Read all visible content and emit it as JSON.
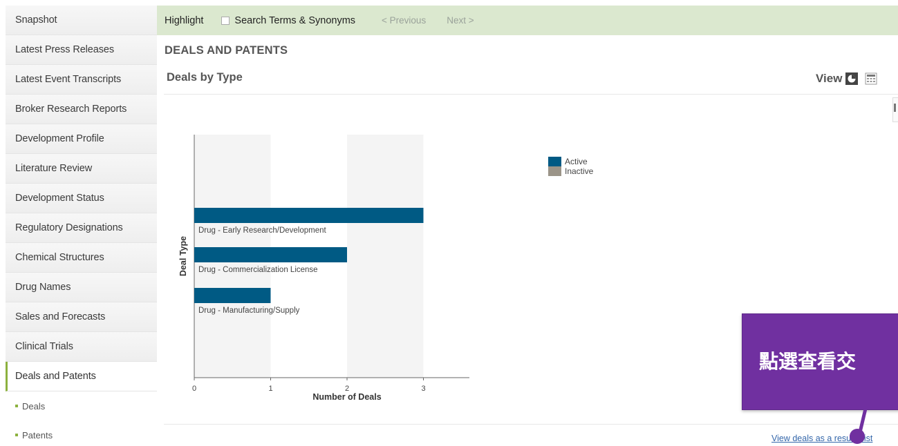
{
  "sidebar": {
    "items": [
      {
        "label": "Snapshot"
      },
      {
        "label": "Latest Press Releases"
      },
      {
        "label": "Latest Event Transcripts"
      },
      {
        "label": "Broker Research Reports"
      },
      {
        "label": "Development Profile"
      },
      {
        "label": "Literature Review"
      },
      {
        "label": "Development Status"
      },
      {
        "label": "Regulatory Designations"
      },
      {
        "label": "Chemical Structures"
      },
      {
        "label": "Drug Names"
      },
      {
        "label": "Sales and Forecasts"
      },
      {
        "label": "Clinical Trials"
      },
      {
        "label": "Deals and Patents"
      }
    ],
    "sub_items": [
      {
        "label": "Deals"
      },
      {
        "label": "Patents"
      }
    ]
  },
  "toolbar": {
    "highlight_label": "Highlight",
    "search_terms_label": "Search Terms & Synonyms",
    "previous_label": "< Previous",
    "next_label": "Next >"
  },
  "main": {
    "page_title": "DEALS AND PATENTS",
    "section_title": "Deals by Type",
    "view_label": "View",
    "link_text": "View deals as a results list"
  },
  "callout": {
    "text": "點選查看交",
    "color": "#7030a0"
  },
  "chart_data": {
    "type": "bar",
    "orientation": "horizontal",
    "categories": [
      "Drug - Early Research/Development",
      "Drug - Commercialization License",
      "Drug - Manufacturing/Supply"
    ],
    "series": [
      {
        "name": "Active",
        "values": [
          3,
          2,
          1
        ],
        "color": "#005a84"
      },
      {
        "name": "Inactive",
        "values": [
          0,
          0,
          0
        ],
        "color": "#9b9488"
      }
    ],
    "xlabel": "Number of Deals",
    "ylabel": "Deal Type",
    "xticks": [
      0,
      1,
      2,
      3
    ],
    "xlim": [
      0,
      4
    ],
    "grid": "alternating vertical bands",
    "legend_position": "right"
  }
}
